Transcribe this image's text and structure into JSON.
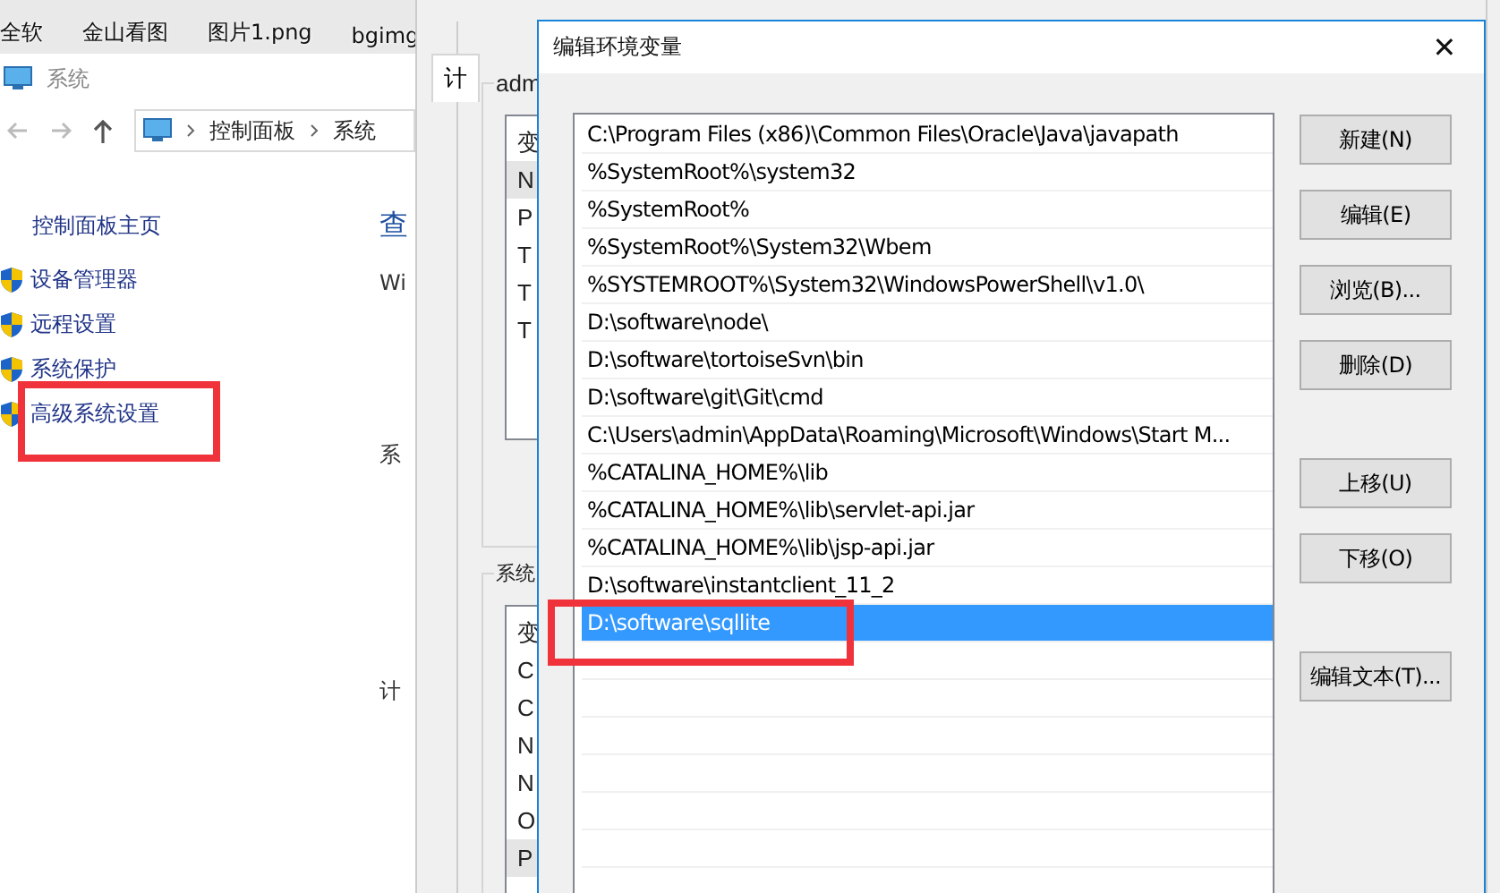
{
  "desktop_icons": [
    {
      "label": "全软"
    },
    {
      "label": "金山看图"
    },
    {
      "label": "图片1.png"
    },
    {
      "label": "bgimg"
    }
  ],
  "system_window": {
    "title": "系统",
    "breadcrumb": [
      "控制面板",
      "系统"
    ],
    "home_link": "控制面板主页",
    "sidebar_items": [
      {
        "label": "设备管理器"
      },
      {
        "label": "远程设置"
      },
      {
        "label": "系统保护"
      },
      {
        "label": "高级系统设置"
      }
    ],
    "content_fragments": [
      {
        "text": "查",
        "kind": "link"
      },
      {
        "text": "Wi",
        "kind": "text"
      },
      {
        "text": "系",
        "kind": "text"
      },
      {
        "text": "计",
        "kind": "text"
      }
    ]
  },
  "env_window": {
    "tab": "计",
    "user_group": "adm",
    "user_header": "变",
    "user_rows": [
      "N",
      "P",
      "T",
      "T",
      "T"
    ],
    "system_group": "系统",
    "system_header": "变",
    "system_rows": [
      "C",
      "C",
      "N",
      "N",
      "O",
      "P"
    ]
  },
  "dialog": {
    "title": "编辑环境变量",
    "close": "✕",
    "paths": [
      {
        "text": "C:\\Program Files (x86)\\Common Files\\Oracle\\Java\\javapath",
        "selected": false
      },
      {
        "text": "%SystemRoot%\\system32",
        "selected": false
      },
      {
        "text": "%SystemRoot%",
        "selected": false
      },
      {
        "text": "%SystemRoot%\\System32\\Wbem",
        "selected": false
      },
      {
        "text": "%SYSTEMROOT%\\System32\\WindowsPowerShell\\v1.0\\",
        "selected": false
      },
      {
        "text": "D:\\software\\node\\",
        "selected": false
      },
      {
        "text": "D:\\software\\tortoiseSvn\\bin",
        "selected": false
      },
      {
        "text": "D:\\software\\git\\Git\\cmd",
        "selected": false
      },
      {
        "text": "C:\\Users\\admin\\AppData\\Roaming\\Microsoft\\Windows\\Start M...",
        "selected": false
      },
      {
        "text": "%CATALINA_HOME%\\lib",
        "selected": false
      },
      {
        "text": "%CATALINA_HOME%\\lib\\servlet-api.jar",
        "selected": false
      },
      {
        "text": "%CATALINA_HOME%\\lib\\jsp-api.jar",
        "selected": false
      },
      {
        "text": "D:\\software\\instantclient_11_2",
        "selected": false
      },
      {
        "text": "D:\\software\\sqllite",
        "selected": true
      }
    ],
    "button_groups": [
      [
        "新建(N)",
        "编辑(E)",
        "浏览(B)...",
        "删除(D)"
      ],
      [
        "上移(U)",
        "下移(O)"
      ],
      [
        "编辑文本(T)..."
      ]
    ]
  }
}
